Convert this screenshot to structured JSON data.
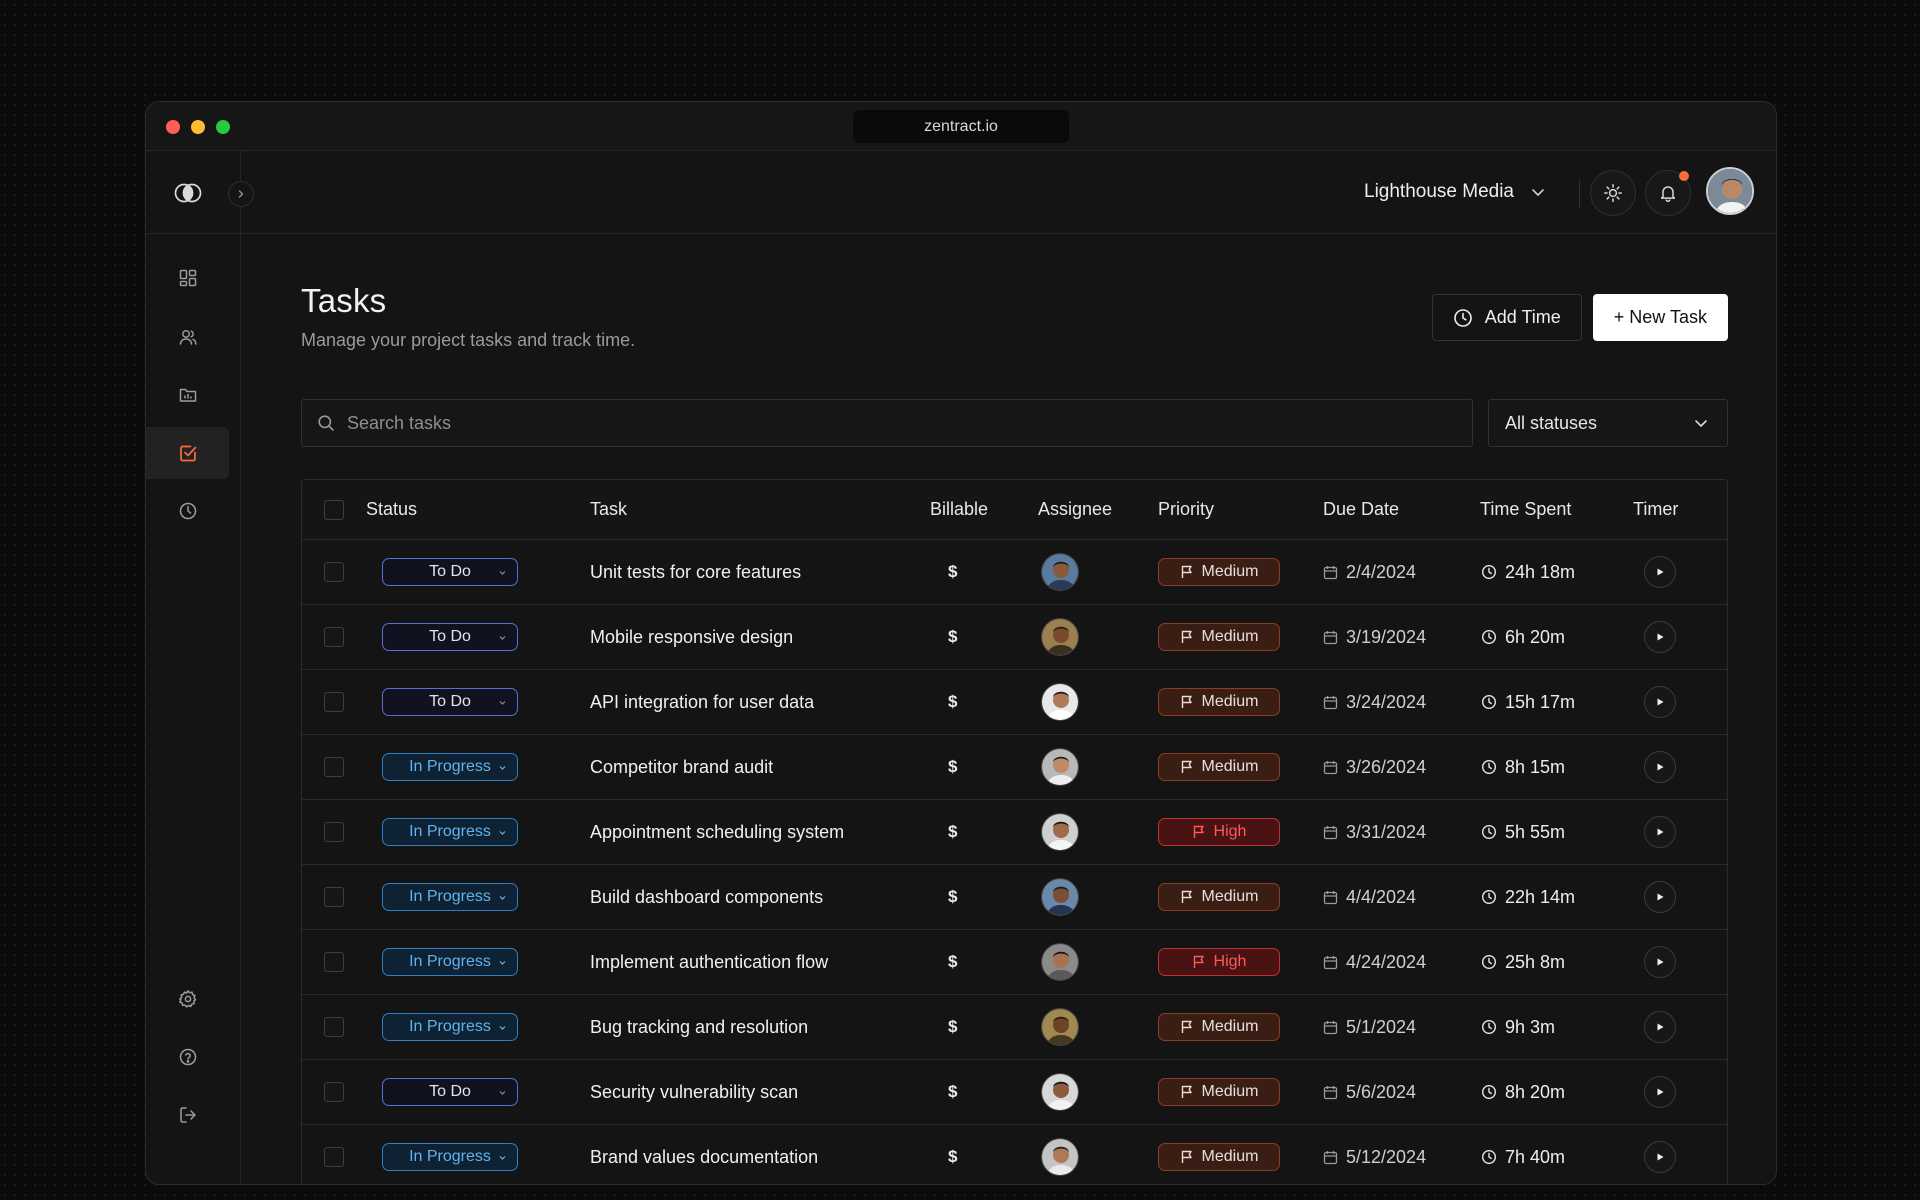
{
  "browser": {
    "url": "zentract.io"
  },
  "header": {
    "workspace": "Lighthouse Media"
  },
  "page": {
    "title": "Tasks",
    "subtitle": "Manage your project tasks and track time.",
    "add_time_label": "Add Time",
    "new_task_label": "+ New Task"
  },
  "filters": {
    "search_placeholder": "Search tasks",
    "status_value": "All statuses"
  },
  "table": {
    "columns": [
      "Status",
      "Task",
      "Billable",
      "Assignee",
      "Priority",
      "Due Date",
      "Time Spent",
      "Timer"
    ],
    "rows": [
      {
        "status": "To Do",
        "task": "Unit tests for core features",
        "billable": "$",
        "priority": "Medium",
        "due": "2/4/2024",
        "spent": "24h 18m"
      },
      {
        "status": "To Do",
        "task": "Mobile responsive design",
        "billable": "$",
        "priority": "Medium",
        "due": "3/19/2024",
        "spent": "6h 20m"
      },
      {
        "status": "To Do",
        "task": "API integration for user data",
        "billable": "$",
        "priority": "Medium",
        "due": "3/24/2024",
        "spent": "15h 17m"
      },
      {
        "status": "In Progress",
        "task": "Competitor brand audit",
        "billable": "$",
        "priority": "Medium",
        "due": "3/26/2024",
        "spent": "8h 15m"
      },
      {
        "status": "In Progress",
        "task": "Appointment scheduling system",
        "billable": "$",
        "priority": "High",
        "due": "3/31/2024",
        "spent": "5h 55m"
      },
      {
        "status": "In Progress",
        "task": "Build dashboard components",
        "billable": "$",
        "priority": "Medium",
        "due": "4/4/2024",
        "spent": "22h 14m"
      },
      {
        "status": "In Progress",
        "task": "Implement authentication flow",
        "billable": "$",
        "priority": "High",
        "due": "4/24/2024",
        "spent": "25h 8m"
      },
      {
        "status": "In Progress",
        "task": "Bug tracking and resolution",
        "billable": "$",
        "priority": "Medium",
        "due": "5/1/2024",
        "spent": "9h 3m"
      },
      {
        "status": "To Do",
        "task": "Security vulnerability scan",
        "billable": "$",
        "priority": "Medium",
        "due": "5/6/2024",
        "spent": "8h 20m"
      },
      {
        "status": "In Progress",
        "task": "Brand values documentation",
        "billable": "$",
        "priority": "Medium",
        "due": "5/12/2024",
        "spent": "7h 40m"
      }
    ]
  },
  "colors": {
    "accent": "#ff6a3d",
    "todo_border": "#5a6fd0",
    "in_progress_border": "#2f7fc4",
    "in_progress_text": "#5fb4f0",
    "medium_bg": "#3a1e13",
    "medium_border": "#8a3f22",
    "high_bg": "#4a1313",
    "high_border": "#c23131"
  }
}
